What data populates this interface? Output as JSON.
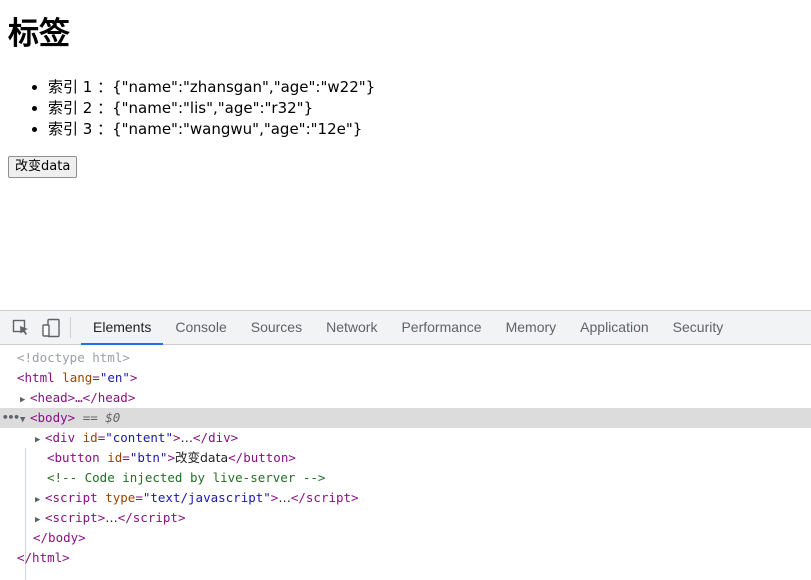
{
  "page": {
    "heading": "标签",
    "items": [
      "索引 1 ：{\"name\":\"zhansgan\",\"age\":\"w22\"}",
      "索引 2 ：{\"name\":\"lis\",\"age\":\"r32\"}",
      "索引 3 ：{\"name\":\"wangwu\",\"age\":\"12e\"}"
    ],
    "button_label": "改变data"
  },
  "devtools": {
    "icons": [
      "inspect-element-icon",
      "device-toggle-icon"
    ],
    "tabs": [
      "Elements",
      "Console",
      "Sources",
      "Network",
      "Performance",
      "Memory",
      "Application",
      "Security"
    ],
    "active_tab": "Elements",
    "tree": {
      "doctype": "<!doctype html>",
      "html_open_tag": "html",
      "html_lang_attr": "lang",
      "html_lang_val": "\"en\"",
      "head": "<head>…</head>",
      "body_tag": "body",
      "body_selected_suffix": "== $0",
      "div_tag": "div",
      "div_id_attr": "id",
      "div_id_val": "\"content\"",
      "div_collapsed": "…",
      "button_tag": "button",
      "button_id_attr": "id",
      "button_id_val": "\"btn\"",
      "button_text": "改变data",
      "comment": "<!-- Code injected by live-server -->",
      "script1_tag": "script",
      "script1_type_attr": "type",
      "script1_type_val": "\"text/javascript\"",
      "script_collapsed": "…",
      "script2_tag": "script",
      "body_close": "</body>",
      "html_close": "</html>"
    }
  },
  "colors": {
    "tag": "#881280",
    "attr_name": "#994500",
    "attr_value": "#1a1aa6",
    "comment": "#236e25",
    "active_tab_underline": "#1a73e8",
    "selected_row": "#dcdcdc"
  }
}
